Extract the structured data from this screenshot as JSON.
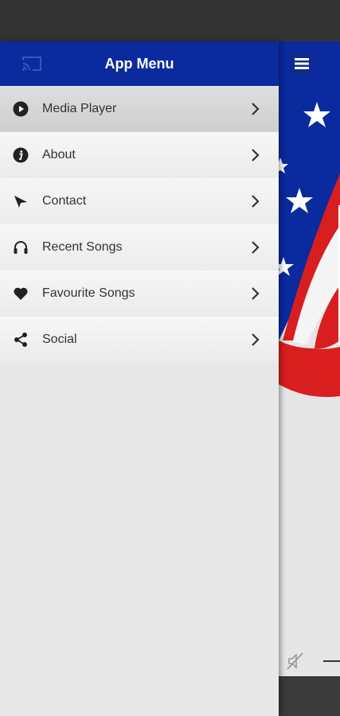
{
  "colors": {
    "header": "#0a2a9e",
    "drawer_bg": "#e8e8e8",
    "status_bar": "#333333",
    "flag_red": "#d81e1e",
    "flag_blue": "#0a2a9e"
  },
  "drawer": {
    "title": "App Menu",
    "cast_icon": "cast-icon"
  },
  "menu": {
    "items": [
      {
        "label": "Media Player",
        "icon": "play-circle-icon"
      },
      {
        "label": "About",
        "icon": "info-icon"
      },
      {
        "label": "Contact",
        "icon": "send-icon"
      },
      {
        "label": "Recent Songs",
        "icon": "headphones-icon"
      },
      {
        "label": "Favourite Songs",
        "icon": "heart-icon"
      },
      {
        "label": "Social",
        "icon": "share-icon"
      }
    ],
    "chevron_icon": "chevron-right-icon"
  },
  "content": {
    "menu_icon": "hamburger-menu-icon",
    "mute_icon": "mute-icon"
  }
}
